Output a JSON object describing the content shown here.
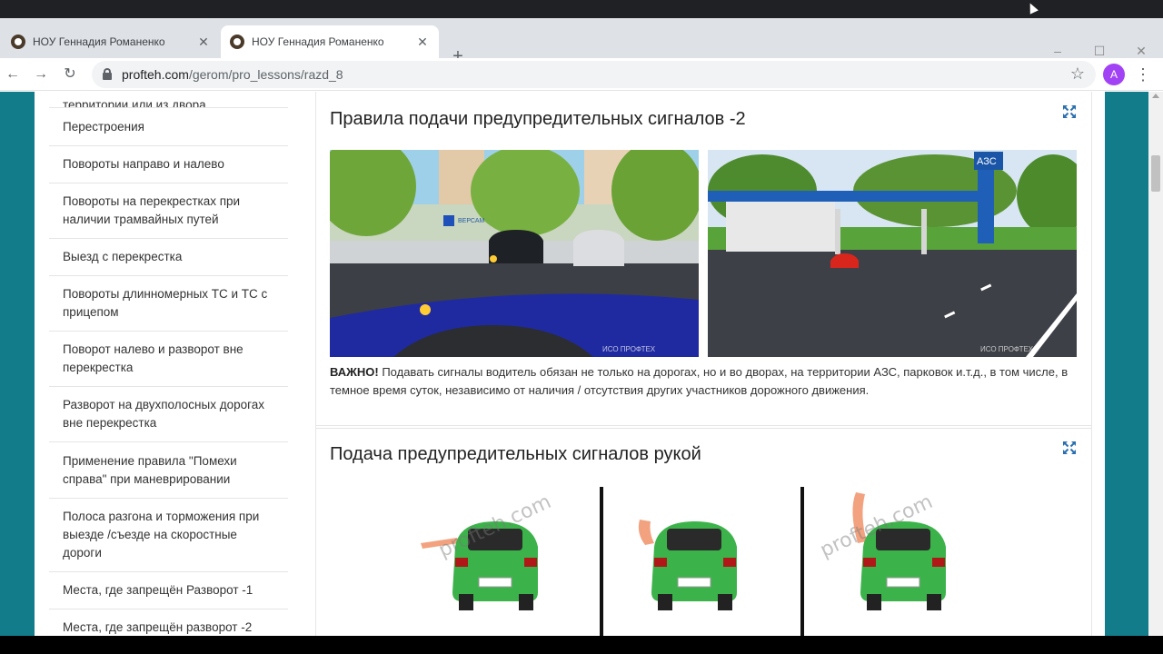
{
  "browser": {
    "tabs": [
      {
        "title": "НОУ Геннадия Романенко",
        "active": false
      },
      {
        "title": "НОУ Геннадия Романенко",
        "active": true
      }
    ],
    "url_host": "profteh.com",
    "url_path": "/gerom/pro_lessons/razd_8",
    "profile_initial": "A"
  },
  "sidebar": {
    "items": [
      {
        "label": "территории или из двора"
      },
      {
        "label": "Перестроения"
      },
      {
        "label": "Повороты направо и налево"
      },
      {
        "label": "Повороты на перекрестках при наличии трамвайных путей"
      },
      {
        "label": "Выезд с перекрестка"
      },
      {
        "label": "Повороты длинномерных ТС и ТС с прицепом"
      },
      {
        "label": "Поворот налево и разворот вне перекрестка"
      },
      {
        "label": "Разворот на двухполосных дорогах вне перекрестка"
      },
      {
        "label": "Применение правила \"Помехи справа\" при маневрировании"
      },
      {
        "label": "Полоса разгона и торможения при выезде /съезде на скоростные дороги"
      },
      {
        "label": "Места, где запрещён Разворот -1"
      },
      {
        "label": "Места, где запрещён разворот -2"
      }
    ]
  },
  "sections": [
    {
      "title": "Правила подачи предупредительных сигналов -2",
      "images": [
        {
          "watermark": "ИСО ПРОФТЕХ",
          "sign": "ВЕРСАМ"
        },
        {
          "watermark": "ИСО ПРОФТЕХ",
          "sign": "АЗС"
        }
      ],
      "note_bold": "ВАЖНО!",
      "note_text": " Подавать сигналы водитель обязан не только на дорогах, но и во дворах, на территории АЗС, парковок и.т.д., в том числе, в темное время суток, независимо от наличия / отсутствия других участников дорожного движения."
    },
    {
      "title": "Подача предупредительных сигналов рукой",
      "watermark": "profteh.com"
    }
  ],
  "colors": {
    "page_bg": "#137c8b",
    "car_green": "#3cb34a",
    "accent_blue": "#1a73e8",
    "avatar": "#a142f4"
  }
}
